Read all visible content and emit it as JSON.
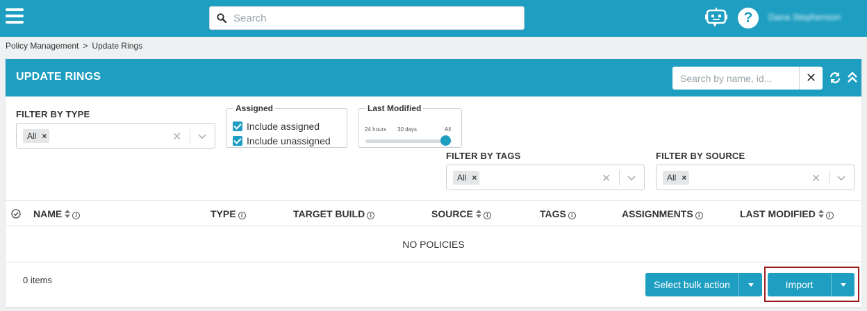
{
  "topbar": {
    "search_placeholder": "Search",
    "user_name": "Dana Stephenson",
    "help_label": "?"
  },
  "breadcrumb": {
    "items": [
      "Policy Management",
      "Update Rings"
    ],
    "separator": ">"
  },
  "card": {
    "title": "UPDATE RINGS",
    "search_placeholder": "Search by name, id..."
  },
  "filters": {
    "type": {
      "label": "FILTER BY TYPE",
      "tag": "All"
    },
    "assigned": {
      "legend": "Assigned",
      "options": [
        {
          "label": "Include assigned",
          "checked": true
        },
        {
          "label": "Include unassigned",
          "checked": true
        }
      ]
    },
    "last_modified": {
      "legend": "Last Modified",
      "ticks": [
        "24 hours",
        "30 days",
        "All"
      ],
      "selected": "All"
    },
    "tags": {
      "label": "FILTER BY TAGS",
      "tag": "All"
    },
    "source": {
      "label": "FILTER BY SOURCE",
      "tag": "All"
    }
  },
  "table": {
    "columns": [
      {
        "label": "NAME",
        "sortable": true
      },
      {
        "label": "TYPE",
        "sortable": false
      },
      {
        "label": "TARGET BUILD",
        "sortable": false
      },
      {
        "label": "SOURCE",
        "sortable": true
      },
      {
        "label": "TAGS",
        "sortable": false
      },
      {
        "label": "ASSIGNMENTS",
        "sortable": false
      },
      {
        "label": "LAST MODIFIED",
        "sortable": true
      }
    ],
    "empty_text": "NO POLICIES"
  },
  "footer": {
    "item_count": "0 items",
    "bulk_action_label": "Select bulk action",
    "import_label": "Import"
  },
  "colors": {
    "primary": "#1e9ec1",
    "highlight_border": "#9b1c1c"
  },
  "icons": [
    "menu-icon",
    "search-icon",
    "bot-icon",
    "help-icon",
    "close-icon",
    "refresh-icon",
    "collapse-icon",
    "chevron-down-icon",
    "sort-icon",
    "info-icon",
    "select-all-icon",
    "checkbox-icon",
    "caret-down-icon"
  ]
}
